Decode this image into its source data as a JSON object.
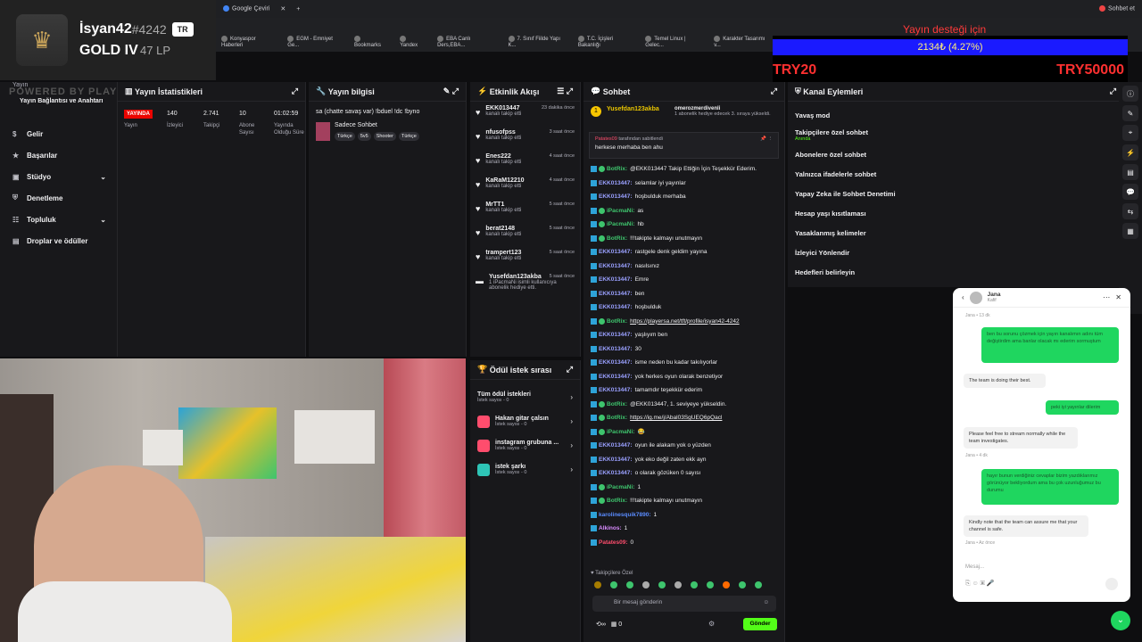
{
  "badge": {
    "name": "İsyan42",
    "tag": "#4242",
    "region": "TR",
    "rank": "GOLD IV",
    "lp": "47 LP"
  },
  "browser": {
    "tab": "Google Çeviri",
    "bookmarks": [
      "Konyaspor Haberleri",
      "EGM - Emniyet Ge...",
      "Bookmarks",
      "Yandex",
      "EBA Canlı Ders,EBA...",
      "7. Sınıf Fiilde Yapı K...",
      "T.C. İçişleri Bakanlığı",
      "Temel Linux | Gelec...",
      "Karakter Tasarımı v..."
    ],
    "profile": "Sohbet et"
  },
  "promo": {
    "goal": "Yayın desteği için",
    "amount": "2134₺ (4.27%)",
    "left": "TRY20",
    "right": "TRY50000"
  },
  "watermark": "POWERED BY PLAYERSE.NET/TFT",
  "nav": {
    "top": "Yayın",
    "sub": "Yayın Bağlantısı ve Anahtarı",
    "items": [
      "Gelir",
      "Başarılar",
      "Stüdyo",
      "Denetleme",
      "Topluluk",
      "Droplar ve ödüller"
    ]
  },
  "stats": {
    "title": "Yayın İstatistikleri",
    "live": "YAYINDA",
    "live_lbl": "Yayın",
    "viewers": "140",
    "viewers_lbl": "İzleyici",
    "followers": "2.741",
    "followers_lbl": "Takipçi",
    "subs": "10",
    "subs_lbl": "Abone Sayısı",
    "time": "01:02:59",
    "time_lbl": "Yayında Olduğu Süre"
  },
  "info": {
    "title": "Yayın bilgisi",
    "stream_title": "sa (chatte savaş var) !bduel !dc !byno",
    "category": "Sadece Sohbet",
    "tags": [
      "Türkçe",
      "5v5",
      "Shooter",
      "Türkçe"
    ]
  },
  "feed": {
    "title": "Etkinlik Akışı",
    "items": [
      {
        "name": "EKK013447",
        "sub": "kanalı takip etti",
        "time": "23 dakika önce"
      },
      {
        "name": "nfusofpss",
        "sub": "kanalı takip etti",
        "time": "3 saat önce"
      },
      {
        "name": "Enes222",
        "sub": "kanalı takip etti",
        "time": "4 saat önce"
      },
      {
        "name": "KaRaM12210",
        "sub": "kanalı takip etti",
        "time": "4 saat önce"
      },
      {
        "name": "MrTT1",
        "sub": "kanalı takip etti",
        "time": "5 saat önce"
      },
      {
        "name": "berat2148",
        "sub": "kanalı takip etti",
        "time": "5 saat önce"
      },
      {
        "name": "trampert123",
        "sub": "kanalı takip etti",
        "time": "5 saat önce"
      },
      {
        "name": "Yusefdan123akba",
        "sub": "1 iPacmaNi isimli kullanıcıya abonelik hediye etti.",
        "time": "5 saat önce"
      }
    ]
  },
  "rewards": {
    "title": "Ödül istek sırası",
    "items": [
      {
        "name": "Tüm ödül istekleri",
        "sub": "İstek sayısı - 0"
      },
      {
        "name": "Hakan gitar çalsın",
        "sub": "İstek sayısı - 0"
      },
      {
        "name": "instagram grubuna ...",
        "sub": "İstek sayısı - 0"
      },
      {
        "name": "istek şarkı",
        "sub": "İstek sayısı - 0"
      }
    ]
  },
  "chat": {
    "title": "Sohbet",
    "gift_user": "Yusefdan123akba",
    "gift_target": "omerozmerdivenli",
    "gift_text": "1 abonelik hediye edecek 3. sıraya yükseldi.",
    "pinned_by": "tarafından sabitlendi",
    "pinned": "herkese merhaba ben ahu",
    "footer": "Takipçilere Özel",
    "placeholder": "Bir mesaj gönderin",
    "send": "Gönder",
    "points": "0",
    "messages": [
      {
        "user": "BotRix:",
        "text": "@EKK013447 Takip Ettiğin İçin Teşekkür Ederim.",
        "c": "#3ec46d",
        "bot": true
      },
      {
        "user": "EKK013447:",
        "text": "selamlar iyi yayınlar",
        "c": "#9aa0ff"
      },
      {
        "user": "EKK013447:",
        "text": "hoşbulduk merhaba",
        "c": "#9aa0ff"
      },
      {
        "user": "iPacmaNi:",
        "text": "as",
        "c": "#3ec46d",
        "bot": true
      },
      {
        "user": "iPacmaNi:",
        "text": "hb",
        "c": "#3ec46d",
        "bot": true
      },
      {
        "user": "BotRix:",
        "text": "!!!takipte kalmayı unutmayın",
        "c": "#3ec46d",
        "bot": true
      },
      {
        "user": "EKK013447:",
        "text": "rastgele denk geldim yayına",
        "c": "#9aa0ff"
      },
      {
        "user": "EKK013447:",
        "text": "nasılsınız",
        "c": "#9aa0ff"
      },
      {
        "user": "EKK013447:",
        "text": "Emre",
        "c": "#9aa0ff"
      },
      {
        "user": "EKK013447:",
        "text": "ben",
        "c": "#9aa0ff"
      },
      {
        "user": "EKK013447:",
        "text": "hoşbulduk",
        "c": "#9aa0ff"
      },
      {
        "user": "BotRix:",
        "text": "https://playersa.net/tft/profile/isyan42-4242",
        "c": "#3ec46d",
        "bot": true,
        "link": true
      },
      {
        "user": "EKK013447:",
        "text": "yaşlıyım ben",
        "c": "#9aa0ff"
      },
      {
        "user": "EKK013447:",
        "text": "30",
        "c": "#9aa0ff"
      },
      {
        "user": "EKK013447:",
        "text": "isme neden bu kadar takılıyorlar",
        "c": "#9aa0ff"
      },
      {
        "user": "EKK013447:",
        "text": "yok herkes oyun olarak benzetiyor",
        "c": "#9aa0ff"
      },
      {
        "user": "EKK013447:",
        "text": "tamamdır teşekkür ederim",
        "c": "#9aa0ff"
      },
      {
        "user": "BotRix:",
        "text": "@EKK013447, 1. seviyeye yükseldin.",
        "c": "#3ec46d",
        "bot": true
      },
      {
        "user": "BotRix:",
        "text": "https://ig.me/j/Abal03SgUEQ6pQacl",
        "c": "#3ec46d",
        "bot": true,
        "link": true
      },
      {
        "user": "iPacmaNi:",
        "text": "😂",
        "c": "#3ec46d",
        "bot": true
      },
      {
        "user": "EKK013447:",
        "text": "oyun ile alakam yok o yüzden",
        "c": "#9aa0ff"
      },
      {
        "user": "EKK013447:",
        "text": "yok eko değil zaten ekk ayn",
        "c": "#9aa0ff"
      },
      {
        "user": "EKK013447:",
        "text": "o olarak gözüken 0 sayısı",
        "c": "#9aa0ff"
      },
      {
        "user": "iPacmaNi:",
        "text": "1",
        "c": "#3ec46d",
        "bot": true
      },
      {
        "user": "BotRix:",
        "text": "!!!takipte kalmayı unutmayın",
        "c": "#3ec46d",
        "bot": true
      },
      {
        "user": "karolinesquik7890:",
        "text": "1",
        "c": "#5a8cff"
      },
      {
        "user": "Alkinos:",
        "text": "1",
        "c": "#d98cff"
      },
      {
        "user": "Patates09:",
        "text": "0",
        "c": "#ff4d6d"
      }
    ]
  },
  "mod": {
    "title": "Kanal Eylemleri",
    "items": [
      {
        "label": "Yavaş mod",
        "ctl": "arrow"
      },
      {
        "label": "Takipçilere özel sohbet",
        "sub": "Anında",
        "ctl": "arrow"
      },
      {
        "label": "Abonelere özel sohbet",
        "ctl": "toggle"
      },
      {
        "label": "Yalnızca ifadelerle sohbet",
        "ctl": "toggle"
      },
      {
        "label": "Yapay Zeka ile Sohbet Denetimi",
        "ctl": "ext"
      },
      {
        "label": "Hesap yaşı kısıtlaması",
        "ctl": "arrow"
      },
      {
        "label": "Yasaklanmış kelimeler",
        "ctl": "arrow"
      },
      {
        "label": "İzleyici Yönlendir",
        "ctl": "none"
      },
      {
        "label": "Hedefleri belirleyin",
        "ctl": "arrow"
      }
    ]
  },
  "support": {
    "name": "Jana",
    "role": "Kafif",
    "t1": "Jana • 13 dk",
    "m1": "ben bu sorunu çözmek için yayın kanalımın adını tüm değiştirdim ama banlar olacak mı ederim sormuştum",
    "m2": "The team is doing their best.",
    "m3": "peki iyi yayınlar dilerim",
    "m4": "Please feel free to stream normally while the team investigates.",
    "t2": "Jana • 4 dk",
    "m5": "hayır bunun verdiğiniz cevaplar bizim yazdıklarımız görünüyor bekliyordum ama bu çok uzunluğumuz bu durumu",
    "m6": "Kindly note that the team can assure me that your channel is safe.",
    "t3": "Jana • Az önce",
    "placeholder": "Mesaj..."
  },
  "colors": {
    "accent": "#53fc18",
    "live": "#eb0400",
    "panel": "#18181b"
  }
}
